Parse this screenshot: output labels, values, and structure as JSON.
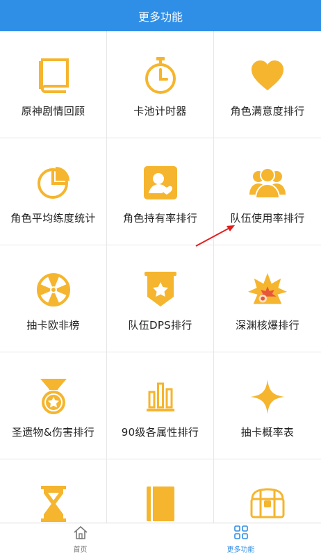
{
  "header": {
    "title": "更多功能"
  },
  "features": [
    {
      "label": "原神剧情回顾",
      "icon": "book-icon"
    },
    {
      "label": "卡池计时器",
      "icon": "stopwatch-icon"
    },
    {
      "label": "角色满意度排行",
      "icon": "heart-icon"
    },
    {
      "label": "角色平均练度统计",
      "icon": "pie-chart-icon"
    },
    {
      "label": "角色持有率排行",
      "icon": "user-card-icon"
    },
    {
      "label": "队伍使用率排行",
      "icon": "group-icon"
    },
    {
      "label": "抽卡欧非榜",
      "icon": "wheel-icon"
    },
    {
      "label": "队伍DPS排行",
      "icon": "star-banner-icon"
    },
    {
      "label": "深渊核爆排行",
      "icon": "explosion-icon"
    },
    {
      "label": "圣遗物&伤害排行",
      "icon": "medal-icon"
    },
    {
      "label": "90级各属性排行",
      "icon": "bar-chart-icon"
    },
    {
      "label": "抽卡概率表",
      "icon": "sparkle-star-icon"
    },
    {
      "label": "",
      "icon": "hourglass-icon"
    },
    {
      "label": "",
      "icon": "notebook-icon"
    },
    {
      "label": "",
      "icon": "treasure-chest-icon"
    }
  ],
  "bottom_nav": {
    "home_label": "首页",
    "more_label": "更多功能"
  },
  "colors": {
    "accent": "#2f8ee6",
    "icon": "#f5b52e",
    "explosion_inner": "#e8563a"
  }
}
